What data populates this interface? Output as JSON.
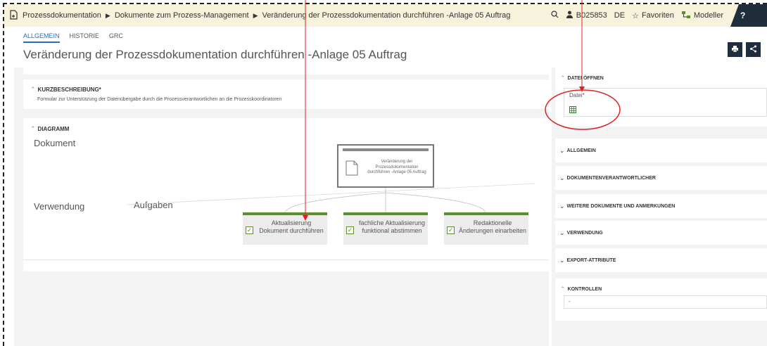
{
  "breadcrumb": {
    "items": [
      "Prozessdokumentation",
      "Dokumente zum Prozess-Management",
      "Veränderung der Prozessdokumentation durchführen -Anlage 05 Auftrag"
    ]
  },
  "topbar": {
    "user_id": "B025853",
    "language": "DE",
    "favorites_label": "Favoriten",
    "modeler_label": "Modeller",
    "help_label": "?"
  },
  "tabs": [
    "ALLGEMEIN",
    "HISTORIE",
    "GRC"
  ],
  "page_title": "Veränderung der Prozessdokumentation durchführen -Anlage 05 Auftrag",
  "kurzbeschreibung": {
    "heading": "KURZBESCHREIBUNG*",
    "text": "Formular zur Unterstützung der Datenübergabe durch die Prozessverantwortlichen an die Prozesskoordinatoren"
  },
  "diagramm": {
    "heading": "DIAGRAMM",
    "dokument_label": "Dokument",
    "verwendung_label": "Verwendung",
    "aufgaben_label": "Aufgaben",
    "document_name": "Veränderung der Prozessdokumentation durchführen -Anlage 05 Auftrag",
    "tasks": [
      {
        "label": "Aktualisierung Dokument durchführen"
      },
      {
        "label": "fachliche Aktualisierung funktional abstimmen"
      },
      {
        "label": "Redaktionelle Änderungen einarbeiten"
      }
    ]
  },
  "right_panel": {
    "datei_oeffnen": {
      "heading": "DATEI ÖFFNEN",
      "field_label": "Datei*"
    },
    "sections": [
      "ALLGEMEIN",
      "DOKUMENTENVERANTWORTLICHER",
      "WEITERE DOKUMENTE UND ANMERKUNGEN",
      "VERWENDUNG",
      "EXPORT-ATTRIBUTE"
    ],
    "kontrollen": {
      "heading": "KONTROLLEN",
      "value": "-"
    }
  },
  "colors": {
    "accent_blue": "#2a6fb2",
    "task_green": "#5b8f2a",
    "annotation_red": "#e02020",
    "dark_navy": "#1f2d3d"
  },
  "icons": [
    "document-plus-icon",
    "search-icon",
    "user-icon",
    "star-icon",
    "modeler-icon",
    "help-icon",
    "print-icon",
    "share-icon",
    "spreadsheet-file-icon",
    "checkbox-icon",
    "document-icon"
  ]
}
